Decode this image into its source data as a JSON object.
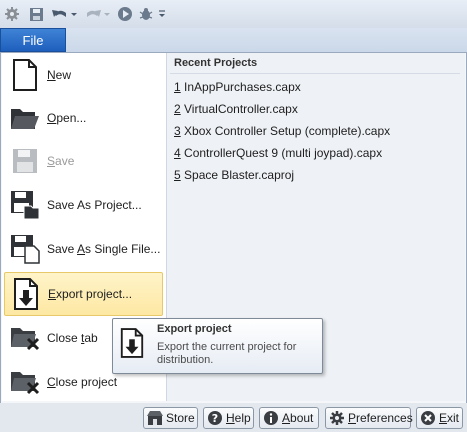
{
  "ribbon": {
    "file_tab": "File"
  },
  "menu": {
    "items": [
      {
        "label": "New",
        "key": "N",
        "rest": "ew"
      },
      {
        "label": "Open...",
        "key": "O",
        "rest": "pen..."
      },
      {
        "label": "Save",
        "key": "S",
        "rest": "ave"
      },
      {
        "label": "Save As Project...",
        "pre": "Save As Pro",
        "key": "j",
        "rest": "ect..."
      },
      {
        "label": "Save As Single File...",
        "pre": "Save ",
        "key": "A",
        "rest": "s Single File..."
      },
      {
        "label": "Export project...",
        "pre": "",
        "key": "E",
        "rest": "xport project..."
      },
      {
        "label": "Close tab",
        "pre": "Close ",
        "key": "t",
        "rest": "ab"
      },
      {
        "label": "Close project",
        "pre": "",
        "key": "C",
        "rest": "lose project"
      }
    ]
  },
  "recent": {
    "title": "Recent Projects",
    "items": [
      {
        "num": "1",
        "name": " InAppPurchases.capx"
      },
      {
        "num": "2",
        "name": " VirtualController.capx"
      },
      {
        "num": "3",
        "name": " Xbox Controller Setup (complete).capx"
      },
      {
        "num": "4",
        "name": " ControllerQuest 9 (multi joypad).capx"
      },
      {
        "num": "5",
        "name": " Space Blaster.caproj"
      }
    ]
  },
  "tooltip": {
    "title": "Export project",
    "description": "Export the current project for distribution."
  },
  "bottom_buttons": [
    {
      "label": "Store",
      "key": "",
      "icon": "store-icon"
    },
    {
      "label": "Help",
      "key": "H",
      "icon": "help-icon"
    },
    {
      "label": "About",
      "key": "A",
      "icon": "info-icon"
    },
    {
      "label": "Preferences",
      "key": "P",
      "icon": "gear-icon"
    },
    {
      "label": "Exit",
      "key": "E",
      "icon": "exit-icon"
    }
  ],
  "colors": {
    "file_tab": "#2a6fcc",
    "highlight": "#fde8a3"
  }
}
